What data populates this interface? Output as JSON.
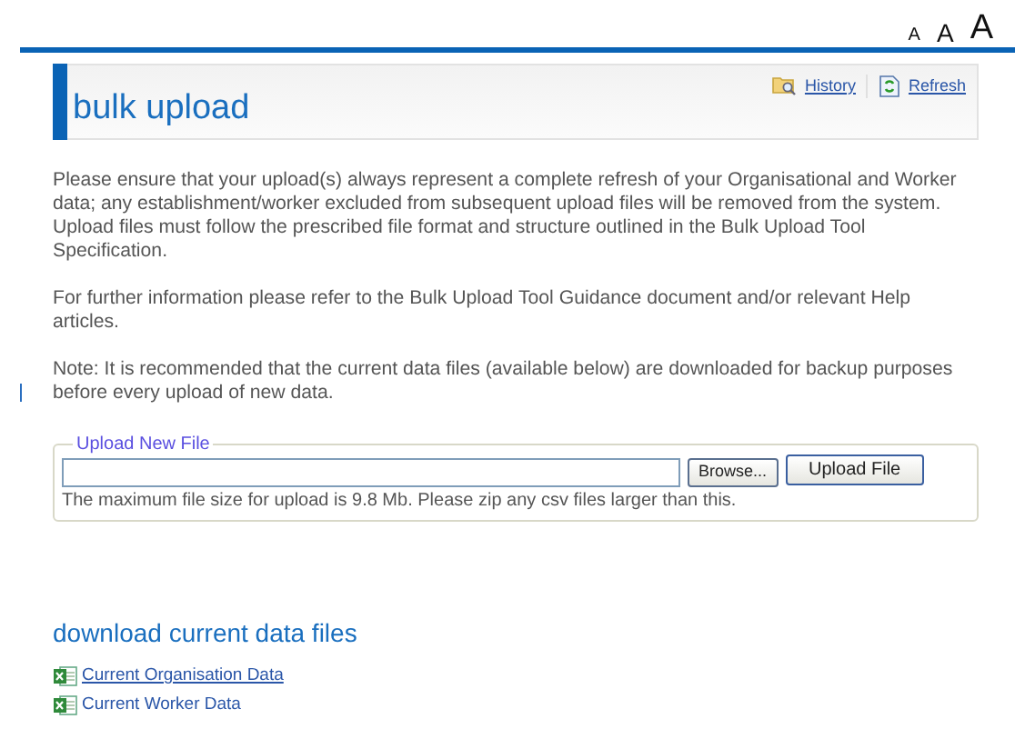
{
  "text_size_options": [
    "A",
    "A",
    "A"
  ],
  "header": {
    "title": "bulk upload",
    "links": [
      {
        "label": "History",
        "kind": "history"
      },
      {
        "label": "Refresh",
        "kind": "refresh"
      }
    ]
  },
  "paragraphs": [
    "Please ensure that your upload(s) always represent a complete refresh of your Organisational and Worker data; any establishment/worker excluded from subsequent upload files will be removed from the system. Upload files must follow the prescribed file format and structure outlined in the Bulk Upload Tool Specification.",
    "For further information please refer to the Bulk Upload Tool Guidance document and/or relevant Help articles.",
    "Note: It is recommended that the current data files (available below) are downloaded for backup purposes before every upload of new data."
  ],
  "upload": {
    "legend": "Upload New File",
    "browse_button": "Browse...",
    "upload_button": "Upload File",
    "note": "The maximum file size for upload is 9.8 Mb. Please zip any csv files larger than this."
  },
  "downloads": {
    "title": "download current data files",
    "files": [
      {
        "label": "Current Organisation Data",
        "underlined": true
      },
      {
        "label": "Current Worker Data",
        "underlined": false
      }
    ]
  }
}
